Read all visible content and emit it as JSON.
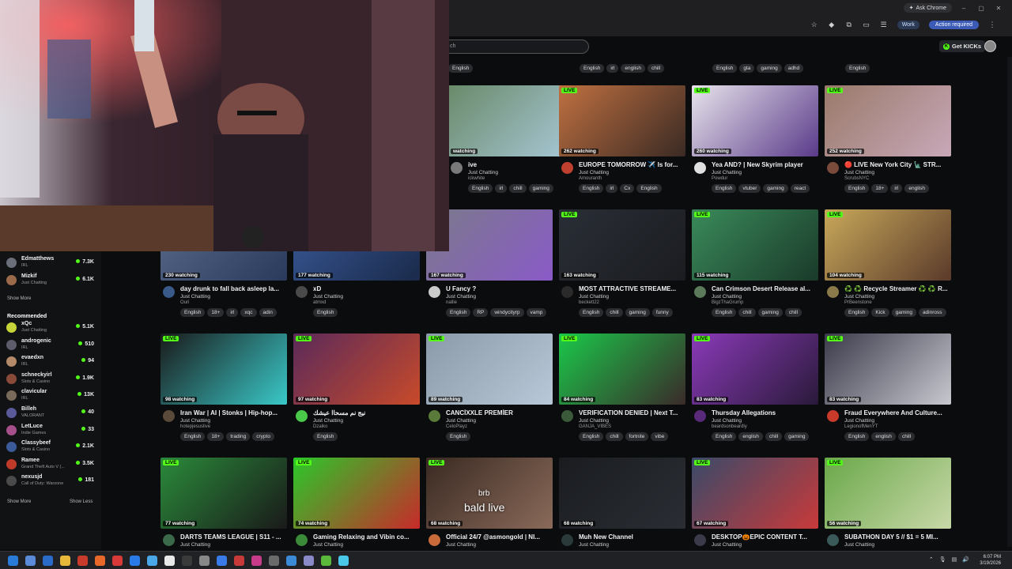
{
  "chrome": {
    "ask_chrome": "Ask Chrome",
    "work_label": "Work",
    "action_label": "Action required",
    "search_placeholder": "ch"
  },
  "header": {
    "get_kicks_label": "Get KICKs"
  },
  "sidebar": {
    "following": [
      {
        "name": "Edmatthews",
        "category": "IRL",
        "count": "7.3K",
        "color": "#6a6f79"
      },
      {
        "name": "Mizkif",
        "category": "Just Chatting",
        "count": "6.1K",
        "color": "#9a6a4a"
      }
    ],
    "show_more_1": "Show More",
    "recommended_heading": "Recommended",
    "recommended": [
      {
        "name": "xQc",
        "category": "Just Chatting",
        "count": "5.1K",
        "color": "#c6d43a"
      },
      {
        "name": "androgenic",
        "category": "IRL",
        "count": "510",
        "color": "#5c5c6a"
      },
      {
        "name": "evaedxn",
        "category": "IRL",
        "count": "94",
        "color": "#b58a6a"
      },
      {
        "name": "schneckyirl",
        "category": "Slots & Casino",
        "count": "1.9K",
        "color": "#8a4a3a"
      },
      {
        "name": "clavicular",
        "category": "IRL",
        "count": "13K",
        "color": "#7a6a5a"
      },
      {
        "name": "Billeh",
        "category": "VALORANT",
        "count": "40",
        "color": "#5a5a9a"
      },
      {
        "name": "LetLuce",
        "category": "Indie Games",
        "count": "33",
        "color": "#a5508a"
      },
      {
        "name": "Classybeef",
        "category": "Slots & Casino",
        "count": "2.1K",
        "color": "#3a5a9a"
      },
      {
        "name": "Ramee",
        "category": "Grand Theft Auto V (...",
        "count": "3.5K",
        "color": "#c03a2a"
      },
      {
        "name": "nexusjd",
        "category": "Call of Duty: Warzone",
        "count": "181",
        "color": "#4a4a4a"
      }
    ],
    "show_more_2": "Show More",
    "show_less": "Show Less"
  },
  "top_row_partial": [
    {
      "user": "",
      "tags": [
        "English"
      ]
    },
    {
      "user": "",
      "tags": [
        "English",
        "irl",
        "english",
        "chill"
      ]
    },
    {
      "user": "",
      "tags": [
        "English",
        "gta",
        "gaming",
        "adhd"
      ]
    },
    {
      "user": "",
      "tags": [
        "English"
      ]
    }
  ],
  "live_label": "LIVE",
  "cards": [
    {
      "watching": "watching",
      "title": "ive",
      "category": "Just Chatting",
      "user": "ickwhite",
      "tags": [
        "English",
        "irl",
        "chill",
        "gaming"
      ],
      "thumb": [
        "#6a8a6a",
        "#a8c8d8"
      ],
      "av": "#7a7a7a",
      "live": false
    },
    {
      "watching": "262 watching",
      "title": "EUROPE TOMORROW ✈️ Is for...",
      "category": "Just Chatting",
      "user": "Amouranth",
      "tags": [
        "English",
        "irl",
        "Cx",
        "English"
      ],
      "thumb": [
        "#c07040",
        "#3a2a24"
      ],
      "av": "#c04030",
      "live": true
    },
    {
      "watching": "260 watching",
      "title": "Yea AND? | New Skyrim player",
      "category": "Just Chatting",
      "user": "Powdur",
      "tags": [
        "English",
        "vtuber",
        "gaming",
        "react"
      ],
      "thumb": [
        "#e8e4ec",
        "#5a3a8a"
      ],
      "av": "#e0e0e0",
      "live": true
    },
    {
      "watching": "252 watching",
      "title": "🔴 LIVE New York City 🗽 STR...",
      "category": "Just Chatting",
      "user": "ScrubsNYC",
      "tags": [
        "English",
        "18+",
        "irl",
        "english"
      ],
      "thumb": [
        "#9a7a6a",
        "#c8a8b8"
      ],
      "av": "#7a4a3a",
      "live": true
    },
    {
      "watching": "230 watching",
      "title": "day drunk to fall back asleep la...",
      "category": "Just Chatting",
      "user": "Ouri",
      "tags": [
        "English",
        "18+",
        "irl",
        "xqc",
        "adin"
      ],
      "thumb": [
        "#5a6a8a",
        "#2a3a5a"
      ],
      "av": "#3a5a8a",
      "live": true
    },
    {
      "watching": "177 watching",
      "title": "xD",
      "category": "Just Chatting",
      "user": "atmxd",
      "tags": [
        "English"
      ],
      "thumb": [
        "#3a5a9a",
        "#1a2a4a"
      ],
      "av": "#4a4a4a",
      "live": true
    },
    {
      "watching": "167 watching",
      "title": "U Fancy ?",
      "category": "Just Chatting",
      "user": "nallie",
      "tags": [
        "English",
        "RP",
        "windycityrp",
        "vamp"
      ],
      "thumb": [
        "#7a7a8a",
        "#8a5ac8"
      ],
      "av": "#cacaca",
      "live": true
    },
    {
      "watching": "163 watching",
      "title": "MOST ATTRACTIVE STREAME...",
      "category": "Just Chatting",
      "user": "beckett22",
      "tags": [
        "English",
        "chill",
        "gaming",
        "funny"
      ],
      "thumb": [
        "#2a2e36",
        "#1a1c20"
      ],
      "av": "#2a2a2a",
      "live": true
    },
    {
      "watching": "115 watching",
      "title": "Can Crimson Desert Release al...",
      "category": "Just Chatting",
      "user": "BigzThaGrump",
      "tags": [
        "English",
        "chill",
        "gaming",
        "chill"
      ],
      "thumb": [
        "#3a8a5a",
        "#1a3a2a"
      ],
      "av": "#5a7a5a",
      "live": true
    },
    {
      "watching": "104 watching",
      "title": "♻️ ♻️ Recycle Streamer ♻️ ♻️ R...",
      "category": "Just Chatting",
      "user": "PrBeenstone",
      "tags": [
        "English",
        "Kick",
        "gaming",
        "adinross"
      ],
      "thumb": [
        "#c8a85a",
        "#5a3a2a"
      ],
      "av": "#8a7a4a",
      "live": true
    },
    {
      "watching": "98 watching",
      "title": "Iran War | AI | Stonks | Hip-hop...",
      "category": "Just Chatting",
      "user": "hotepjesuslive",
      "tags": [
        "English",
        "18+",
        "trading",
        "crypto"
      ],
      "thumb": [
        "#1a1a1a",
        "#3ac8c8"
      ],
      "av": "#5a4a3a",
      "live": true
    },
    {
      "watching": "97 watching",
      "title": "نيج نم مسحاا عيشك",
      "category": "Just Chatting",
      "user": "Dzaiko",
      "tags": [
        "English"
      ],
      "thumb": [
        "#5a2a5a",
        "#c84a2a"
      ],
      "av": "#4ac84a",
      "live": true
    },
    {
      "watching": "89 watching",
      "title": "CANCÌXXLE PREMÌER",
      "category": "Just Chatting",
      "user": "CeloPlayz",
      "tags": [
        "English"
      ],
      "thumb": [
        "#8a9aa8",
        "#b8c8d8"
      ],
      "av": "#5a7a3a",
      "live": true
    },
    {
      "watching": "84 watching",
      "title": "VERIFICATION DENIED | Next T...",
      "category": "Just Chatting",
      "user": "GANJA_VIBES",
      "tags": [
        "English",
        "chill",
        "fortnite",
        "vibe"
      ],
      "thumb": [
        "#1ac84a",
        "#3a2a2a"
      ],
      "av": "#3a5a3a",
      "live": true
    },
    {
      "watching": "83 watching",
      "title": "Thursday Allegations",
      "category": "Just Chatting",
      "user": "beardsonbeardly",
      "tags": [
        "English",
        "english",
        "chill",
        "gaming"
      ],
      "thumb": [
        "#8a3ab8",
        "#2a1a3a"
      ],
      "av": "#5a2a7a",
      "live": true
    },
    {
      "watching": "83 watching",
      "title": "Fraud Everywhere And Culture...",
      "category": "Just Chatting",
      "user": "LegionofMenYT",
      "tags": [
        "English",
        "english",
        "chill"
      ],
      "thumb": [
        "#3a3a4a",
        "#c8c8d0"
      ],
      "av": "#c83a2a",
      "live": true
    },
    {
      "watching": "77 watching",
      "title": "DARTS TEAMS LEAGUE | S11 - ...",
      "category": "Just Chatting",
      "user": "",
      "tags": [],
      "thumb": [
        "#2a8a3a",
        "#1a1a1a"
      ],
      "av": "#3a6a4a",
      "live": true
    },
    {
      "watching": "74 watching",
      "title": "Gaming Relaxing and Vibin co...",
      "category": "Just Chatting",
      "user": "",
      "tags": [],
      "thumb": [
        "#2ac82a",
        "#c82a2a"
      ],
      "av": "#3a8a3a",
      "live": true
    },
    {
      "watching": "68 watching",
      "title": "Official 24/7 @asmongold | NI...",
      "category": "Just Chatting",
      "user": "",
      "tags": [],
      "thumb": [
        "#3a2a22",
        "#8a6a5a"
      ],
      "av": "#c86a3a",
      "live": true
    },
    {
      "watching": "68 watching",
      "title": "Muh New Channel",
      "category": "Just Chatting",
      "user": "",
      "tags": [],
      "thumb": [
        "#1a1c20",
        "#2a2e34"
      ],
      "av": "#2a3a3a",
      "live": false
    },
    {
      "watching": "67 watching",
      "title": "DESKTOP🎃EPIC CONTENT T...",
      "category": "Just Chatting",
      "user": "",
      "tags": [],
      "thumb": [
        "#3a4a6a",
        "#c83a3a"
      ],
      "av": "#3a3a4a",
      "live": true
    },
    {
      "watching": "56 watching",
      "title": "SUBATHON DAY 5 // $1 = 5 MI...",
      "category": "Just Chatting",
      "user": "",
      "tags": [],
      "thumb": [
        "#6aa84a",
        "#c8d8a8"
      ],
      "av": "#3a5a5a",
      "live": true
    }
  ],
  "overlay_text": "bald live",
  "overlay_small": "brb",
  "taskbar": {
    "time": "6:07 PM",
    "date": "3/19/2026"
  }
}
